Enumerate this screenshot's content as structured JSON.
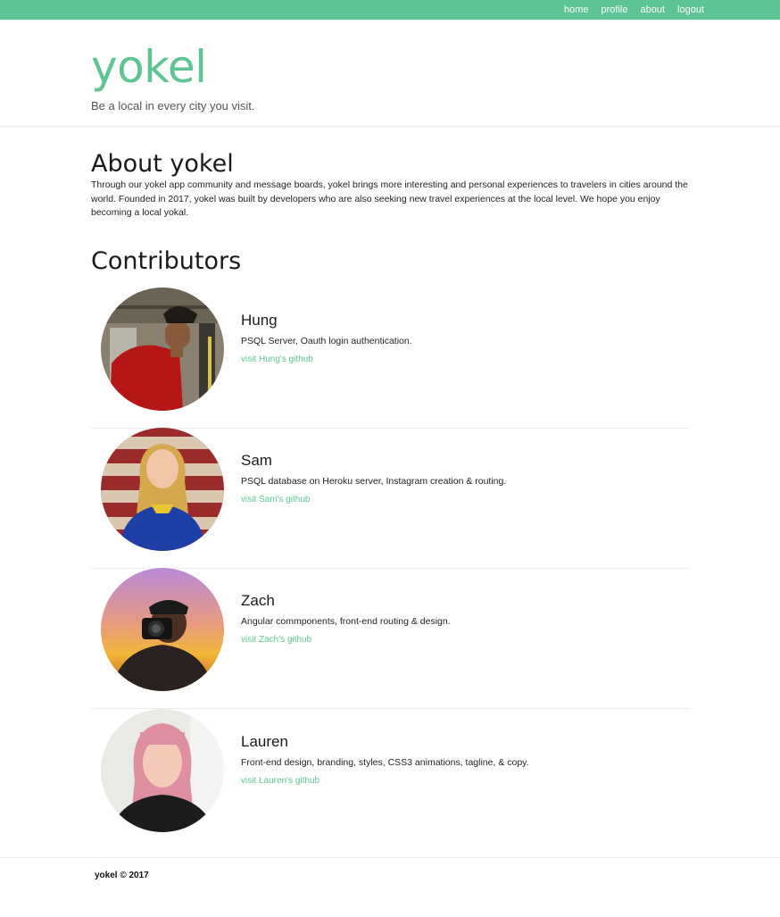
{
  "nav": {
    "items": [
      "home",
      "profile",
      "about",
      "logout"
    ]
  },
  "hero": {
    "brand": "yokel",
    "tagline": "Be a local in every city you visit."
  },
  "about": {
    "title": "About yokel",
    "text": "Through our yokel app community and message boards, yokel brings more interesting and personal experiences to travelers in cities around the world. Founded in 2017, yokel was built by developers who are also seeking new travel experiences at the local level. We hope you enjoy becoming a local yokal."
  },
  "contributors": {
    "title": "Contributors",
    "people": [
      {
        "name": "Hung",
        "desc": "PSQL Server, Oauth login authentication.",
        "link": "visit Hung's github"
      },
      {
        "name": "Sam",
        "desc": "PSQL database on Heroku server, Instagram creation & routing.",
        "link": "visit Sam's github"
      },
      {
        "name": "Zach",
        "desc": "Angular commponents, front-end routing & design.",
        "link": "visit Zach's github"
      },
      {
        "name": "Lauren",
        "desc": "Front-end design, branding, styles, CSS3 animations, tagline, & copy.",
        "link": "visit Lauren's github"
      }
    ]
  },
  "footer": {
    "copyright": "yokel © 2017"
  },
  "colors": {
    "accent": "#5ec493",
    "text": "#222222",
    "divider": "#ececec"
  }
}
